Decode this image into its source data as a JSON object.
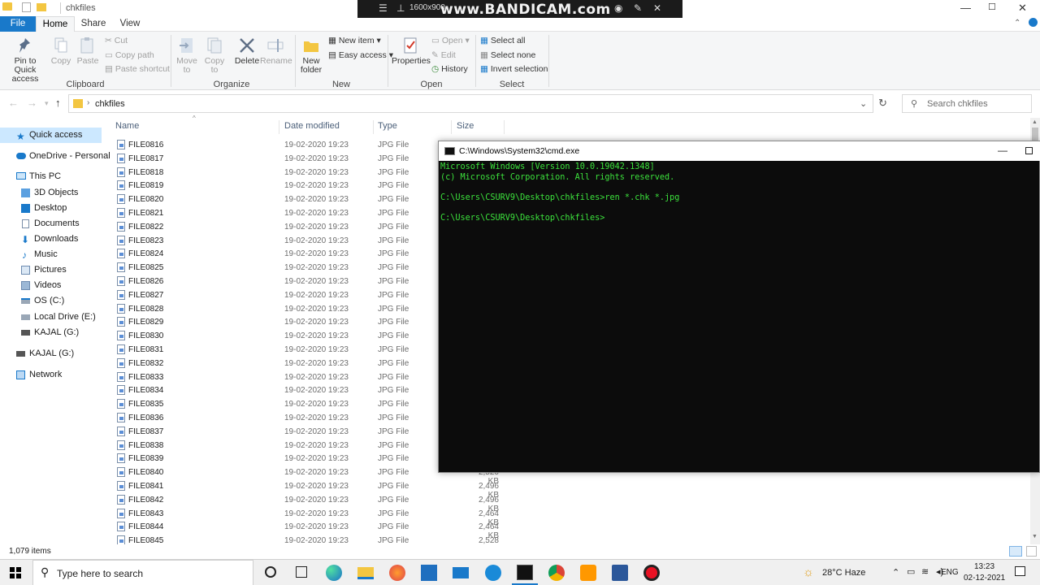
{
  "window": {
    "title": "chkfiles",
    "controls": [
      "—",
      "☐",
      "✕"
    ]
  },
  "bandicam": {
    "resolution": "1600x900",
    "brand": "www.BANDICAM.com"
  },
  "ribbon_tabs": [
    "File",
    "Home",
    "Share",
    "View"
  ],
  "ribbon": {
    "clipboard": {
      "pin": "Pin to Quick access",
      "copy": "Copy",
      "paste": "Paste",
      "cut": "Cut",
      "copy_path": "Copy path",
      "paste_shortcut": "Paste shortcut",
      "label": "Clipboard"
    },
    "organize": {
      "move_to": "Move to",
      "copy_to": "Copy to",
      "delete": "Delete",
      "rename": "Rename",
      "label": "Organize"
    },
    "new": {
      "new_folder": "New folder",
      "new_item": "New item",
      "easy_access": "Easy access",
      "label": "New"
    },
    "open": {
      "properties": "Properties",
      "open": "Open",
      "edit": "Edit",
      "history": "History",
      "label": "Open"
    },
    "select": {
      "select_all": "Select all",
      "select_none": "Select none",
      "invert": "Invert selection",
      "label": "Select"
    }
  },
  "address": {
    "path": "chkfiles",
    "search_placeholder": "Search chkfiles"
  },
  "nav": {
    "items": [
      {
        "label": "Quick access",
        "icon": "star-icon",
        "indent": 0
      },
      {
        "label": "OneDrive - Personal",
        "icon": "cloud-icon",
        "indent": 0
      },
      {
        "label": "This PC",
        "icon": "pc-icon",
        "indent": 0
      },
      {
        "label": "3D Objects",
        "icon": "cube-icon",
        "indent": 1
      },
      {
        "label": "Desktop",
        "icon": "desktop-icon",
        "indent": 1
      },
      {
        "label": "Documents",
        "icon": "document-icon",
        "indent": 1
      },
      {
        "label": "Downloads",
        "icon": "download-icon",
        "indent": 1
      },
      {
        "label": "Music",
        "icon": "music-icon",
        "indent": 1
      },
      {
        "label": "Pictures",
        "icon": "pictures-icon",
        "indent": 1
      },
      {
        "label": "Videos",
        "icon": "video-icon",
        "indent": 1
      },
      {
        "label": "OS (C:)",
        "icon": "drive-icon",
        "indent": 1
      },
      {
        "label": "Local Drive (E:)",
        "icon": "drive-icon",
        "indent": 1
      },
      {
        "label": "KAJAL (G:)",
        "icon": "usb-drive-icon",
        "indent": 1
      },
      {
        "label": "KAJAL (G:)",
        "icon": "usb-drive-icon",
        "indent": 0
      },
      {
        "label": "Network",
        "icon": "network-icon",
        "indent": 0
      }
    ]
  },
  "columns": {
    "name": "Name",
    "date": "Date modified",
    "type": "Type",
    "size": "Size"
  },
  "files": [
    {
      "name": "FILE0816",
      "date": "19-02-2020 19:23",
      "type": "JPG File",
      "size": ""
    },
    {
      "name": "FILE0817",
      "date": "19-02-2020 19:23",
      "type": "JPG File",
      "size": ""
    },
    {
      "name": "FILE0818",
      "date": "19-02-2020 19:23",
      "type": "JPG File",
      "size": ""
    },
    {
      "name": "FILE0819",
      "date": "19-02-2020 19:23",
      "type": "JPG File",
      "size": ""
    },
    {
      "name": "FILE0820",
      "date": "19-02-2020 19:23",
      "type": "JPG File",
      "size": ""
    },
    {
      "name": "FILE0821",
      "date": "19-02-2020 19:23",
      "type": "JPG File",
      "size": ""
    },
    {
      "name": "FILE0822",
      "date": "19-02-2020 19:23",
      "type": "JPG File",
      "size": ""
    },
    {
      "name": "FILE0823",
      "date": "19-02-2020 19:23",
      "type": "JPG File",
      "size": ""
    },
    {
      "name": "FILE0824",
      "date": "19-02-2020 19:23",
      "type": "JPG File",
      "size": ""
    },
    {
      "name": "FILE0825",
      "date": "19-02-2020 19:23",
      "type": "JPG File",
      "size": ""
    },
    {
      "name": "FILE0826",
      "date": "19-02-2020 19:23",
      "type": "JPG File",
      "size": ""
    },
    {
      "name": "FILE0827",
      "date": "19-02-2020 19:23",
      "type": "JPG File",
      "size": ""
    },
    {
      "name": "FILE0828",
      "date": "19-02-2020 19:23",
      "type": "JPG File",
      "size": ""
    },
    {
      "name": "FILE0829",
      "date": "19-02-2020 19:23",
      "type": "JPG File",
      "size": ""
    },
    {
      "name": "FILE0830",
      "date": "19-02-2020 19:23",
      "type": "JPG File",
      "size": ""
    },
    {
      "name": "FILE0831",
      "date": "19-02-2020 19:23",
      "type": "JPG File",
      "size": ""
    },
    {
      "name": "FILE0832",
      "date": "19-02-2020 19:23",
      "type": "JPG File",
      "size": ""
    },
    {
      "name": "FILE0833",
      "date": "19-02-2020 19:23",
      "type": "JPG File",
      "size": ""
    },
    {
      "name": "FILE0834",
      "date": "19-02-2020 19:23",
      "type": "JPG File",
      "size": ""
    },
    {
      "name": "FILE0835",
      "date": "19-02-2020 19:23",
      "type": "JPG File",
      "size": ""
    },
    {
      "name": "FILE0836",
      "date": "19-02-2020 19:23",
      "type": "JPG File",
      "size": ""
    },
    {
      "name": "FILE0837",
      "date": "19-02-2020 19:23",
      "type": "JPG File",
      "size": ""
    },
    {
      "name": "FILE0838",
      "date": "19-02-2020 19:23",
      "type": "JPG File",
      "size": ""
    },
    {
      "name": "FILE0839",
      "date": "19-02-2020 19:23",
      "type": "JPG File",
      "size": ""
    },
    {
      "name": "FILE0840",
      "date": "19-02-2020 19:23",
      "type": "JPG File",
      "size": "2,520 KB"
    },
    {
      "name": "FILE0841",
      "date": "19-02-2020 19:23",
      "type": "JPG File",
      "size": "2,496 KB"
    },
    {
      "name": "FILE0842",
      "date": "19-02-2020 19:23",
      "type": "JPG File",
      "size": "2,496 KB"
    },
    {
      "name": "FILE0843",
      "date": "19-02-2020 19:23",
      "type": "JPG File",
      "size": "2,464 KB"
    },
    {
      "name": "FILE0844",
      "date": "19-02-2020 19:23",
      "type": "JPG File",
      "size": "2,464 KB"
    },
    {
      "name": "FILE0845",
      "date": "19-02-2020 19:23",
      "type": "JPG File",
      "size": "2,528 KB"
    }
  ],
  "status": {
    "count": "1,079 items"
  },
  "cmd": {
    "title": "C:\\Windows\\System32\\cmd.exe",
    "lines": [
      "Microsoft Windows [Version 10.0.19042.1348]",
      "(c) Microsoft Corporation. All rights reserved.",
      "",
      "C:\\Users\\CSURV9\\Desktop\\chkfiles>ren *.chk *.jpg",
      "",
      "C:\\Users\\CSURV9\\Desktop\\chkfiles>"
    ],
    "text_color": "#3ce23c"
  },
  "taskbar": {
    "search_placeholder": "Type here to search",
    "weather": "28°C  Haze",
    "lang": "ENG",
    "time": "13:23",
    "date": "02-12-2021"
  },
  "colors": {
    "accent": "#1979ca",
    "ribbon_bg": "#f5f6f7"
  }
}
